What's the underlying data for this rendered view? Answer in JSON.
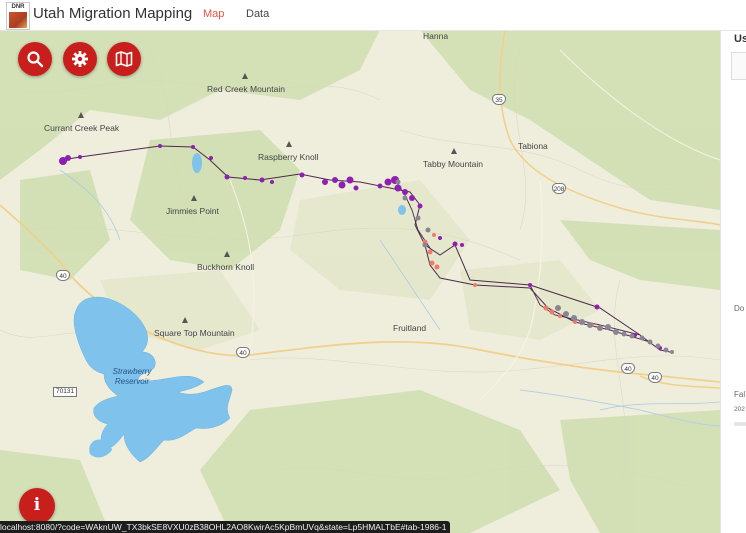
{
  "header": {
    "logo_text": "DNR",
    "title": "Utah Migration Mapping",
    "tabs": [
      {
        "label": "Map",
        "active": true
      },
      {
        "label": "Data",
        "active": false
      }
    ]
  },
  "map": {
    "peaks": [
      {
        "name": "Red Creek Mountain"
      },
      {
        "name": "Currant Creek Peak"
      },
      {
        "name": "Raspberry Knoll"
      },
      {
        "name": "Tabby Mountain"
      },
      {
        "name": "Jimmies Point"
      },
      {
        "name": "Buckhorn Knoll"
      },
      {
        "name": "Square Top Mountain"
      }
    ],
    "towns": [
      {
        "name": "Hanna"
      },
      {
        "name": "Tabiona"
      },
      {
        "name": "Fruitland"
      }
    ],
    "water": {
      "name": "Strawberry Reservoir"
    },
    "highway_shields": [
      "35",
      "208",
      "40",
      "40",
      "40",
      "40",
      "70131"
    ],
    "track_colors": {
      "purple": "#8f1fb0",
      "salmon": "#f07a6a",
      "gray": "#8a8494",
      "line": "#4a2a4a"
    }
  },
  "controls": {
    "search_icon": "search-icon",
    "settings_icon": "gear-icon",
    "layers_icon": "map-icon",
    "info_icon": "i"
  },
  "side_panel": {
    "title": "Us",
    "mid_label": "Do",
    "lower_label": "Fal",
    "lower_value": "202"
  },
  "status_url": "localhost:8080/?code=WAknUW_TX3bkSE8VXU0zB38OHL2AO8KwirAc5KpBmUVq&state=Lp5HMALTbE#tab-1986-1"
}
